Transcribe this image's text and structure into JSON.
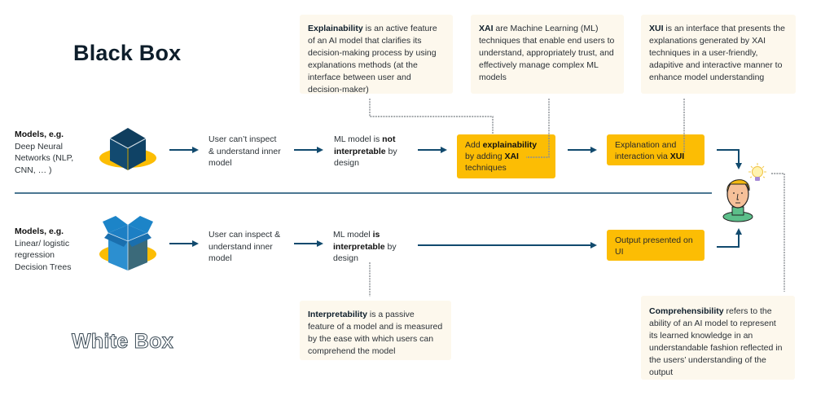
{
  "titles": {
    "black_box": "Black Box",
    "white_box": "White Box"
  },
  "notes": {
    "explainability": {
      "term": "Explainability",
      "rest": " is an active feature of an AI model that clarifies its decision-making process by using explanations methods (at the interface between user and decision-maker)"
    },
    "xai": {
      "term": "XAI",
      "rest": " are Machine Learning (ML) techniques that enable end users to understand, appropriately trust, and effectively manage complex ML models"
    },
    "xui": {
      "term": "XUI",
      "rest": " is an interface that presents the explanations generated by XAI techniques in a user-friendly, adapitive and interactive manner to enhance model understanding"
    },
    "interpretability": {
      "term": "Interpretability",
      "rest": " is a passive feature of a model and is measured by the ease with which users can comprehend the model"
    },
    "comprehensibility": {
      "term": "Comprehensibility",
      "rest": " refers to the ability of an AI model to represent its learned knowledge in an understandable fashion reflected in the users’ understanding of the output"
    }
  },
  "black_row": {
    "models_heading": "Models, e.g.",
    "models_examples": "Deep Neural Networks (NLP, CNN, … )",
    "step1": "User can’t inspect & understand inner model",
    "step2_pre": "ML model is ",
    "step2_bold": "not interpretable",
    "step2_post": " by design",
    "box1_pre": "Add ",
    "box1_bold1": "explainability",
    "box1_mid": " by adding ",
    "box1_bold2": "XAI",
    "box1_post": " techniques",
    "box2_pre": "Explanation and interaction via ",
    "box2_bold": "XUI"
  },
  "white_row": {
    "models_heading": "Models, e.g.",
    "models_examples_1": "Linear/ logistic regression",
    "models_examples_2": "Decision Trees",
    "step1": "User can inspect & understand inner model",
    "step2_pre": "ML model ",
    "step2_bold": "is interpretable",
    "step2_post": "  by design",
    "box1": "Output presented on UI"
  },
  "icons": {
    "black_box_icon": "closed-cube-icon",
    "white_box_icon": "open-box-icon",
    "user_icon": "user-avatar-icon",
    "insight_icon": "lightbulb-icon"
  },
  "colors": {
    "accent_yellow": "#fcbd04",
    "navy": "#114a6e",
    "note_bg": "#fdf8ed",
    "dashed": "#8a8f94"
  }
}
